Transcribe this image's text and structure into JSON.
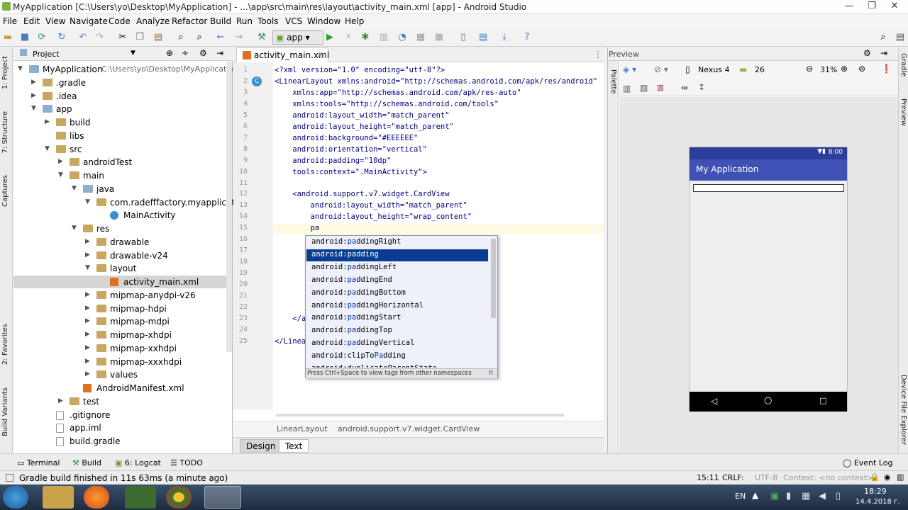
{
  "window": {
    "title": "MyApplication [C:\\Users\\yo\\Desktop\\MyApplication] - ...\\app\\src\\main\\res\\layout\\activity_main.xml [app] - Android Studio",
    "min": "—",
    "max": "❐",
    "close": "✕"
  },
  "menu": [
    "File",
    "Edit",
    "View",
    "Navigate",
    "Code",
    "Analyze",
    "Refactor",
    "Build",
    "Run",
    "Tools",
    "VCS",
    "Window",
    "Help"
  ],
  "toolbar": {
    "run_config": "app"
  },
  "left_strip": [
    "1: Project",
    "7: Structure",
    "Captures",
    "2: Favorites",
    "Build Variants"
  ],
  "project": {
    "header": "Project",
    "tree": [
      {
        "label": "MyApplication",
        "extra": "C:\\Users\\yo\\Desktop\\MyApplication",
        "indent": 0,
        "arrow": "▼",
        "icon": "folder-blue"
      },
      {
        "label": ".gradle",
        "indent": 1,
        "arrow": "▶",
        "icon": "folder"
      },
      {
        "label": ".idea",
        "indent": 1,
        "arrow": "▶",
        "icon": "folder"
      },
      {
        "label": "app",
        "indent": 1,
        "arrow": "▼",
        "icon": "folder-blue"
      },
      {
        "label": "build",
        "indent": 2,
        "arrow": "▶",
        "icon": "folder"
      },
      {
        "label": "libs",
        "indent": 2,
        "arrow": "",
        "icon": "folder"
      },
      {
        "label": "src",
        "indent": 2,
        "arrow": "▼",
        "icon": "folder"
      },
      {
        "label": "androidTest",
        "indent": 3,
        "arrow": "▶",
        "icon": "folder"
      },
      {
        "label": "main",
        "indent": 3,
        "arrow": "▼",
        "icon": "folder"
      },
      {
        "label": "java",
        "indent": 4,
        "arrow": "▼",
        "icon": "folder-blue"
      },
      {
        "label": "com.radefffactory.myapplication",
        "indent": 5,
        "arrow": "▼",
        "icon": "folder"
      },
      {
        "label": "MainActivity",
        "indent": 6,
        "arrow": "",
        "icon": "class"
      },
      {
        "label": "res",
        "indent": 4,
        "arrow": "▼",
        "icon": "folder"
      },
      {
        "label": "drawable",
        "indent": 5,
        "arrow": "▶",
        "icon": "folder"
      },
      {
        "label": "drawable-v24",
        "indent": 5,
        "arrow": "▶",
        "icon": "folder"
      },
      {
        "label": "layout",
        "indent": 5,
        "arrow": "▼",
        "icon": "folder"
      },
      {
        "label": "activity_main.xml",
        "indent": 6,
        "arrow": "",
        "icon": "xml",
        "selected": true
      },
      {
        "label": "mipmap-anydpi-v26",
        "indent": 5,
        "arrow": "▶",
        "icon": "folder"
      },
      {
        "label": "mipmap-hdpi",
        "indent": 5,
        "arrow": "▶",
        "icon": "folder"
      },
      {
        "label": "mipmap-mdpi",
        "indent": 5,
        "arrow": "▶",
        "icon": "folder"
      },
      {
        "label": "mipmap-xhdpi",
        "indent": 5,
        "arrow": "▶",
        "icon": "folder"
      },
      {
        "label": "mipmap-xxhdpi",
        "indent": 5,
        "arrow": "▶",
        "icon": "folder"
      },
      {
        "label": "mipmap-xxxhdpi",
        "indent": 5,
        "arrow": "▶",
        "icon": "folder"
      },
      {
        "label": "values",
        "indent": 5,
        "arrow": "▶",
        "icon": "folder"
      },
      {
        "label": "AndroidManifest.xml",
        "indent": 4,
        "arrow": "",
        "icon": "xml"
      },
      {
        "label": "test",
        "indent": 3,
        "arrow": "▶",
        "icon": "folder"
      },
      {
        "label": ".gitignore",
        "indent": 2,
        "arrow": "",
        "icon": "file"
      },
      {
        "label": "app.iml",
        "indent": 2,
        "arrow": "",
        "icon": "file"
      },
      {
        "label": "build.gradle",
        "indent": 2,
        "arrow": "",
        "icon": "gradle"
      }
    ]
  },
  "editor": {
    "tab": "activity_main.xml",
    "lines": [
      {
        "n": "1",
        "t": "<?xml version=\"1.0\" encoding=\"utf-8\"?>"
      },
      {
        "n": "2",
        "t": "<LinearLayout xmlns:android=\"http://schemas.android.com/apk/res/android\""
      },
      {
        "n": "3",
        "t": "    xmlns:app=\"http://schemas.android.com/apk/res-auto\""
      },
      {
        "n": "4",
        "t": "    xmlns:tools=\"http://schemas.android.com/tools\""
      },
      {
        "n": "5",
        "t": "    android:layout_width=\"match_parent\""
      },
      {
        "n": "6",
        "t": "    android:layout_height=\"match_parent\""
      },
      {
        "n": "7",
        "t": "    android:background=\"#EEEEEE\""
      },
      {
        "n": "8",
        "t": "    android:orientation=\"vertical\""
      },
      {
        "n": "9",
        "t": "    android:padding=\"10dp\""
      },
      {
        "n": "10",
        "t": "    tools:context=\".MainActivity\">"
      },
      {
        "n": "11",
        "t": ""
      },
      {
        "n": "12",
        "t": "    <android.support.v7.widget.CardView"
      },
      {
        "n": "13",
        "t": "        android:layout_width=\"match_parent\""
      },
      {
        "n": "14",
        "t": "        android:layout_height=\"wrap_content\""
      },
      {
        "n": "15",
        "t": "        pa"
      },
      {
        "n": "16",
        "t": ""
      },
      {
        "n": "17",
        "t": ""
      },
      {
        "n": "18",
        "t": ""
      },
      {
        "n": "19",
        "t": ""
      },
      {
        "n": "20",
        "t": ""
      },
      {
        "n": "21",
        "t": "                                             />"
      },
      {
        "n": "22",
        "t": ""
      },
      {
        "n": "23",
        "t": "    </a"
      },
      {
        "n": "24",
        "t": ""
      },
      {
        "n": "25",
        "t": "</Linea"
      }
    ],
    "autocomplete": [
      {
        "pre": "android:",
        "hl": "pa",
        "post": "ddingRight"
      },
      {
        "pre": "android:",
        "hl": "pa",
        "post": "dding",
        "selected": true
      },
      {
        "pre": "android:",
        "hl": "pa",
        "post": "ddingLeft"
      },
      {
        "pre": "android:",
        "hl": "pa",
        "post": "ddingEnd"
      },
      {
        "pre": "android:",
        "hl": "pa",
        "post": "ddingBottom"
      },
      {
        "pre": "android:",
        "hl": "pa",
        "post": "ddingHorizontal"
      },
      {
        "pre": "android:",
        "hl": "pa",
        "post": "ddingStart"
      },
      {
        "pre": "android:",
        "hl": "pa",
        "post": "ddingTop"
      },
      {
        "pre": "android:",
        "hl": "pa",
        "post": "ddingVertical"
      },
      {
        "pre": "android:clipTo",
        "hl": "Pa",
        "post": "dding"
      },
      {
        "pre": "android:duplicateParentState",
        "hl": "",
        "post": ""
      }
    ],
    "autocomplete_hint": "Press Ctrl+Space to view tags from other namespaces",
    "breadcrumb": [
      "LinearLayout",
      "android.support.v7.widget.CardView"
    ],
    "tabs": [
      "Design",
      "Text"
    ]
  },
  "preview": {
    "header": "Preview",
    "device": "Nexus 4",
    "api": "26",
    "zoom": "31%",
    "phone_time": "8:00",
    "app_title": "My Application",
    "palette": "Palette"
  },
  "right_strip": [
    "Gradle",
    "Preview",
    "Device File Explorer"
  ],
  "bottom_tools": [
    "Terminal",
    "Build",
    "6: Logcat",
    "TODO",
    "Event Log"
  ],
  "status": {
    "message": "Gradle build finished in 11s 63ms (a minute ago)",
    "pos": "15:11",
    "crlf": "CRLF:",
    "enc": "UTF-8",
    "context": "Context: <no context>"
  },
  "taskbar": {
    "lang": "EN",
    "time": "18:29",
    "date": "14.4.2018 г."
  },
  "colors": {
    "accent": "#3f51b5",
    "selection": "#0a3d91",
    "primaryDark": "#2c3e9a"
  }
}
